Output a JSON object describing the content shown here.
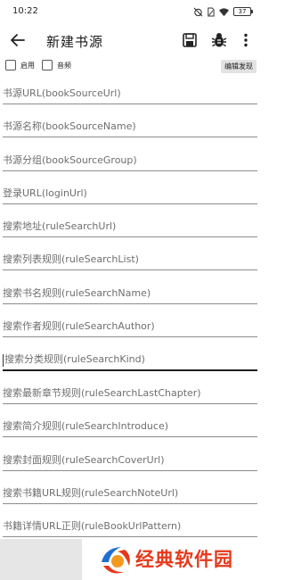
{
  "status_bar": {
    "time": "10:22",
    "battery": "37"
  },
  "toolbar": {
    "title": "新建书源",
    "icons": [
      "back-arrow-icon",
      "save-icon",
      "bug-icon",
      "more-vert-icon"
    ]
  },
  "options": {
    "enable_label": "启用",
    "audio_label": "音频",
    "edit_discover_label": "编辑发现"
  },
  "fields": [
    {
      "placeholder": "书源URL(bookSourceUrl)",
      "value": ""
    },
    {
      "placeholder": "书源名称(bookSourceName)",
      "value": ""
    },
    {
      "placeholder": "书源分组(bookSourceGroup)",
      "value": ""
    },
    {
      "placeholder": "登录URL(loginUrl)",
      "value": ""
    },
    {
      "placeholder": "搜索地址(ruleSearchUrl)",
      "value": ""
    },
    {
      "placeholder": "搜索列表规则(ruleSearchList)",
      "value": ""
    },
    {
      "placeholder": "搜索书名规则(ruleSearchName)",
      "value": ""
    },
    {
      "placeholder": "搜索作者规则(ruleSearchAuthor)",
      "value": ""
    },
    {
      "placeholder": "搜索分类规则(ruleSearchKind)",
      "value": ""
    },
    {
      "placeholder": "搜索最新章节规则(ruleSearchLastChapter)",
      "value": ""
    },
    {
      "placeholder": "搜索简介规则(ruleSearchIntroduce)",
      "value": ""
    },
    {
      "placeholder": "搜索封面规则(ruleSearchCoverUrl)",
      "value": ""
    },
    {
      "placeholder": "搜索书籍URL规则(ruleSearchNoteUrl)",
      "value": ""
    },
    {
      "placeholder": "书籍详情URL正则(ruleBookUrlPattern)",
      "value": ""
    }
  ],
  "watermark": {
    "text": "经典软件园"
  },
  "colors": {
    "watermark_red": "#e5391b",
    "watermark_blue": "#1f6fd1"
  }
}
